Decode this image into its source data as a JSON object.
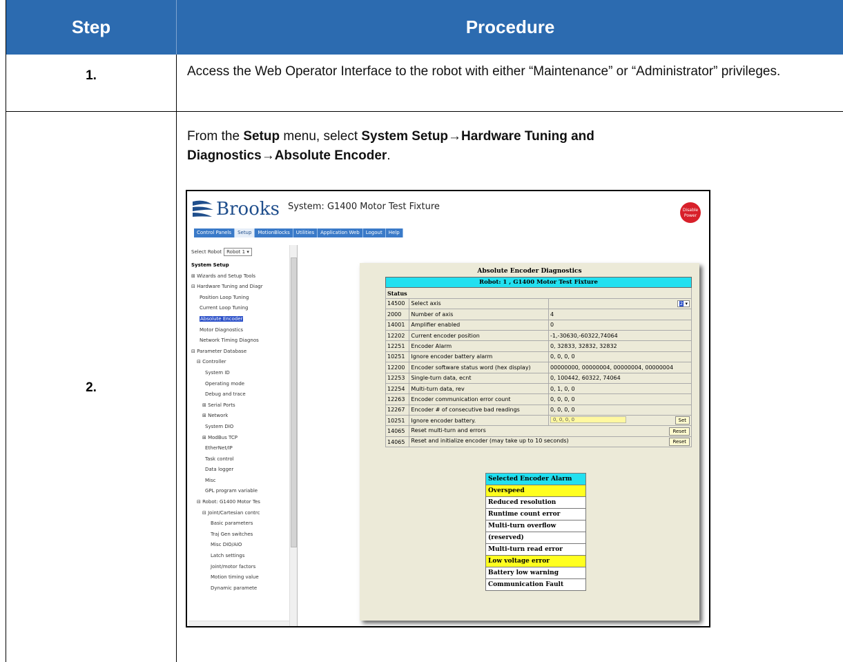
{
  "header": {
    "step": "Step",
    "procedure": "Procedure"
  },
  "steps": [
    {
      "number": "1.",
      "text": "Access the Web Operator Interface to the robot with either “Maintenance” or “Administrator” privileges."
    },
    {
      "number": "2.",
      "line1_prefix": "From the ",
      "line1_setup": "Setup",
      "line1_mid": " menu, select ",
      "line1_path1": "System Setup",
      "arrow": "→",
      "line1_path2": "Hardware Tuning and",
      "line2_path2": "Diagnostics",
      "line2_path3": "Absolute Encoder",
      "line2_suffix": "."
    }
  ],
  "screenshot": {
    "brand": "Brooks",
    "system_title": "System: G1400 Motor Test Fixture",
    "power_button": "Disable Power",
    "nav": [
      "Control Panels",
      "Setup",
      "MotionBlocks",
      "Utilities",
      "Application Web",
      "Logout",
      "Help"
    ],
    "select_robot_label": "Select Robot",
    "select_robot_value": "Robot 1",
    "tree": [
      "System Setup",
      "⊞ Wizards and Setup Tools",
      "⊟ Hardware Tuning and Diagr",
      "Position Loop Tuning",
      "Current Loop Tuning",
      "Absolute Encoder",
      "Motor Diagnostics",
      "Network Timing Diagnos",
      "⊟ Parameter Database",
      "⊟ Controller",
      "System ID",
      "Operating mode",
      "Debug and trace",
      "⊞ Serial Ports",
      "⊞ Network",
      "System DIO",
      "⊞ ModBus TCP",
      "EtherNet/IP",
      "Task control",
      "Data logger",
      "Misc",
      "GPL program variable",
      "⊟ Robot: G1400 Motor Tes",
      "⊟ Joint/Cartesian contrc",
      "Basic parameters",
      "Traj Gen switches",
      "Misc DIO/AIO",
      "Latch settings",
      "Joint/motor factors",
      "Motion timing value",
      "Dynamic paramete"
    ],
    "panel_title": "Absolute Encoder Diagnostics",
    "robot_row": "Robot: 1 , G1400 Motor Test Fixture",
    "status_label": "Status",
    "rows": [
      {
        "id": "14500",
        "label": "Select axis",
        "value": "",
        "select": "2"
      },
      {
        "id": "2000",
        "label": "Number of axis",
        "value": "4"
      },
      {
        "id": "14001",
        "label": "Amplifier enabled",
        "value": "0"
      },
      {
        "id": "12202",
        "label": "Current encoder position",
        "value": "-1,-30630,-60322,74064"
      },
      {
        "id": "12251",
        "label": "Encoder Alarm",
        "value": "0, 32833, 32832, 32832"
      },
      {
        "id": "10251",
        "label": "Ignore encoder battery alarm",
        "value": "0, 0, 0, 0"
      },
      {
        "id": "12200",
        "label": "Encoder software status word (hex display)",
        "value": "00000000, 00000004, 00000004, 00000004"
      },
      {
        "id": "12253",
        "label": "Single-turn data, ecnt",
        "value": "0, 100442, 60322, 74064"
      },
      {
        "id": "12254",
        "label": "Multi-turn data, rev",
        "value": "0, 1, 0, 0"
      },
      {
        "id": "12263",
        "label": "Encoder communication error count",
        "value": "0, 0, 0, 0"
      },
      {
        "id": "12267",
        "label": "Encoder # of consecutive bad readings",
        "value": "0, 0, 0, 0"
      }
    ],
    "action_rows": [
      {
        "id": "10251",
        "label": "Ignore encoder battery.",
        "input": "0, 0, 0, 0",
        "button": "Set"
      },
      {
        "id": "14065",
        "label": "Reset multi-turn and errors",
        "button": "Reset"
      },
      {
        "id": "14065",
        "label": "Reset and initialize encoder (may take up to 10 seconds)",
        "button": "Reset"
      }
    ],
    "alarm_title": "Selected Encoder Alarm",
    "alarms": [
      {
        "label": "Overspeed",
        "active": true
      },
      {
        "label": "Reduced resolution",
        "active": false
      },
      {
        "label": "Runtime count error",
        "active": false
      },
      {
        "label": "Multi-turn overflow",
        "active": false
      },
      {
        "label": "(reserved)",
        "active": false
      },
      {
        "label": "Multi-turn read error",
        "active": false
      },
      {
        "label": "Low voltage error",
        "active": true
      },
      {
        "label": "Battery low warning",
        "active": false
      },
      {
        "label": "Communication Fault",
        "active": false
      }
    ],
    "colors": {
      "header_blue": "#2c6bb0",
      "cyan": "#22e0f0",
      "alarm_yellow": "#ffff20"
    }
  }
}
